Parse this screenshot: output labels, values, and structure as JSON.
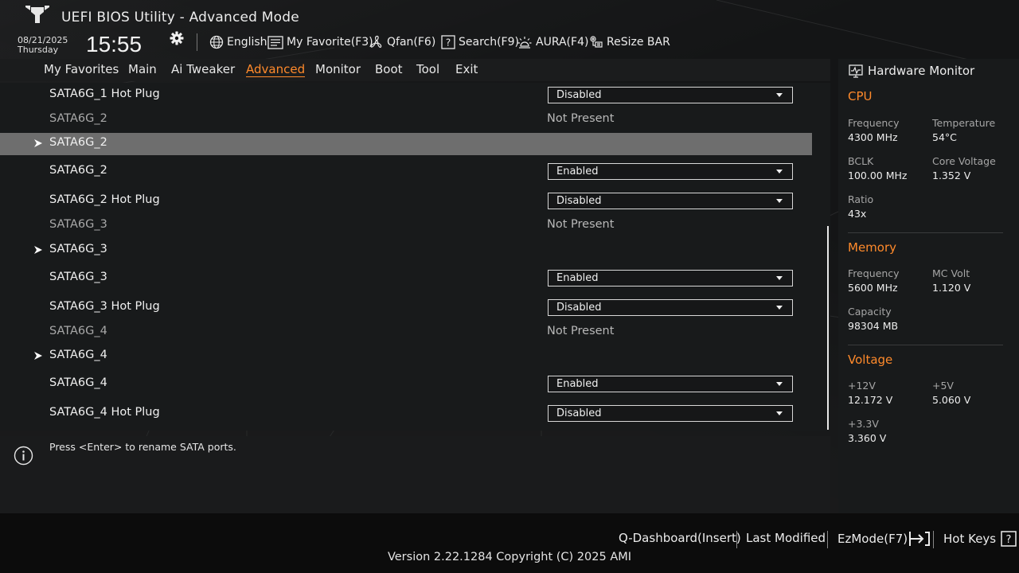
{
  "header": {
    "title": "UEFI BIOS Utility - Advanced Mode",
    "date": "08/21/2025",
    "day": "Thursday",
    "time": "15:55",
    "tools": [
      {
        "label": "English",
        "icon": "globe-icon"
      },
      {
        "label": "My Favorite(F3)",
        "icon": "favorite-list-icon"
      },
      {
        "label": "Qfan(F6)",
        "icon": "fan-icon"
      },
      {
        "label": "Search(F9)",
        "icon": "search-icon"
      },
      {
        "label": "AURA(F4)",
        "icon": "aura-light-icon"
      },
      {
        "label": "ReSize BAR",
        "icon": "resize-bar-icon"
      }
    ]
  },
  "tabs": [
    {
      "label": "My Favorites"
    },
    {
      "label": "Main"
    },
    {
      "label": "Ai Tweaker"
    },
    {
      "label": "Advanced"
    },
    {
      "label": "Monitor"
    },
    {
      "label": "Boot"
    },
    {
      "label": "Tool"
    },
    {
      "label": "Exit"
    }
  ],
  "active_tab": "Advanced",
  "settings": [
    {
      "label": "SATA6G_1 Hot Plug",
      "kind": "dropdown",
      "value": "Disabled"
    },
    {
      "label": "SATA6G_2",
      "kind": "info",
      "value": "Not Present"
    },
    {
      "label": "SATA6G_2",
      "kind": "submenu",
      "selected": true
    },
    {
      "label": "SATA6G_2",
      "kind": "dropdown",
      "value": "Enabled"
    },
    {
      "label": "SATA6G_2 Hot Plug",
      "kind": "dropdown",
      "value": "Disabled"
    },
    {
      "label": "SATA6G_3",
      "kind": "info",
      "value": "Not Present"
    },
    {
      "label": "SATA6G_3",
      "kind": "submenu"
    },
    {
      "label": "SATA6G_3",
      "kind": "dropdown",
      "value": "Enabled"
    },
    {
      "label": "SATA6G_3 Hot Plug",
      "kind": "dropdown",
      "value": "Disabled"
    },
    {
      "label": "SATA6G_4",
      "kind": "info",
      "value": "Not Present"
    },
    {
      "label": "SATA6G_4",
      "kind": "submenu"
    },
    {
      "label": "SATA6G_4",
      "kind": "dropdown",
      "value": "Enabled"
    },
    {
      "label": "SATA6G_4 Hot Plug",
      "kind": "dropdown",
      "value": "Disabled"
    }
  ],
  "help": {
    "text": "Press <Enter> to rename SATA ports."
  },
  "hw_monitor": {
    "title": "Hardware Monitor",
    "cpu": {
      "heading": "CPU",
      "frequency_label": "Frequency",
      "frequency": "4300 MHz",
      "temperature_label": "Temperature",
      "temperature": "54°C",
      "bclk_label": "BCLK",
      "bclk": "100.00 MHz",
      "core_voltage_label": "Core Voltage",
      "core_voltage": "1.352 V",
      "ratio_label": "Ratio",
      "ratio": "43x"
    },
    "memory": {
      "heading": "Memory",
      "frequency_label": "Frequency",
      "frequency": "5600 MHz",
      "mc_volt_label": "MC Volt",
      "mc_volt": "1.120 V",
      "capacity_label": "Capacity",
      "capacity": "98304 MB"
    },
    "voltage": {
      "heading": "Voltage",
      "v12_label": "+12V",
      "v12": "12.172 V",
      "v5_label": "+5V",
      "v5": "5.060 V",
      "v33_label": "+3.3V",
      "v33": "3.360 V"
    }
  },
  "footer": {
    "qdashboard": "Q-Dashboard(Insert)",
    "last_modified": "Last Modified",
    "ezmode": "EzMode(F7)",
    "hotkeys": "Hot Keys",
    "version": "Version 2.22.1284 Copyright (C) 2025 AMI"
  },
  "colors": {
    "accent": "#ff8a2b",
    "selected_row": "#6e6e6e",
    "background": "#141516"
  }
}
